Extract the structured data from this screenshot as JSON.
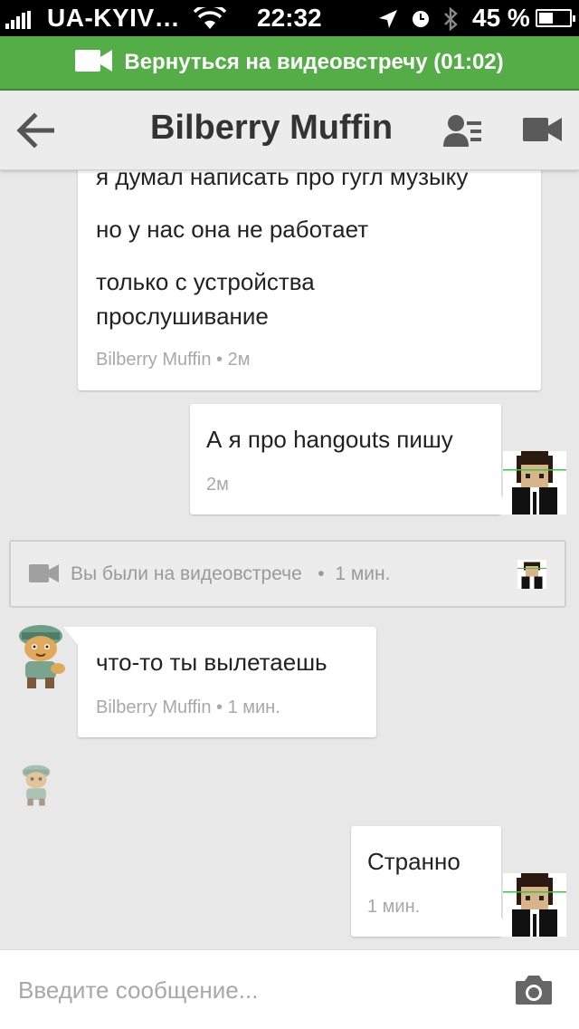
{
  "status_bar": {
    "carrier": "UA-KYIV…",
    "time": "22:32",
    "battery_pct": "45 %",
    "battery_level": 0.45
  },
  "call_banner": {
    "label": "Вернуться на видеовстречу (01:02)",
    "icon": "video-camera-icon",
    "color": "#54ad47"
  },
  "header": {
    "title": "Bilberry Muffin",
    "back_icon": "back-arrow-icon",
    "people_icon": "people-icon",
    "video_icon": "video-camera-icon"
  },
  "messages": [
    {
      "lines": [
        "я думал написать про гугл музыку",
        "но у нас она не работает",
        "только с устройства",
        "прослушивание"
      ],
      "meta": "Bilberry Muffin • 2м"
    },
    {
      "lines": [
        "А я про hangouts пишу"
      ],
      "meta": "2м"
    },
    {
      "hangout_text": "Вы были на видеовстрече   •  1 мин."
    },
    {
      "lines": [
        "что-то ты вылетаешь"
      ],
      "meta": "Bilberry Muffin • 1 мин."
    },
    {
      "lines": [
        "Странно"
      ],
      "meta": "1 мин."
    }
  ],
  "composer": {
    "placeholder": "Введите сообщение...",
    "camera_icon": "camera-icon"
  }
}
